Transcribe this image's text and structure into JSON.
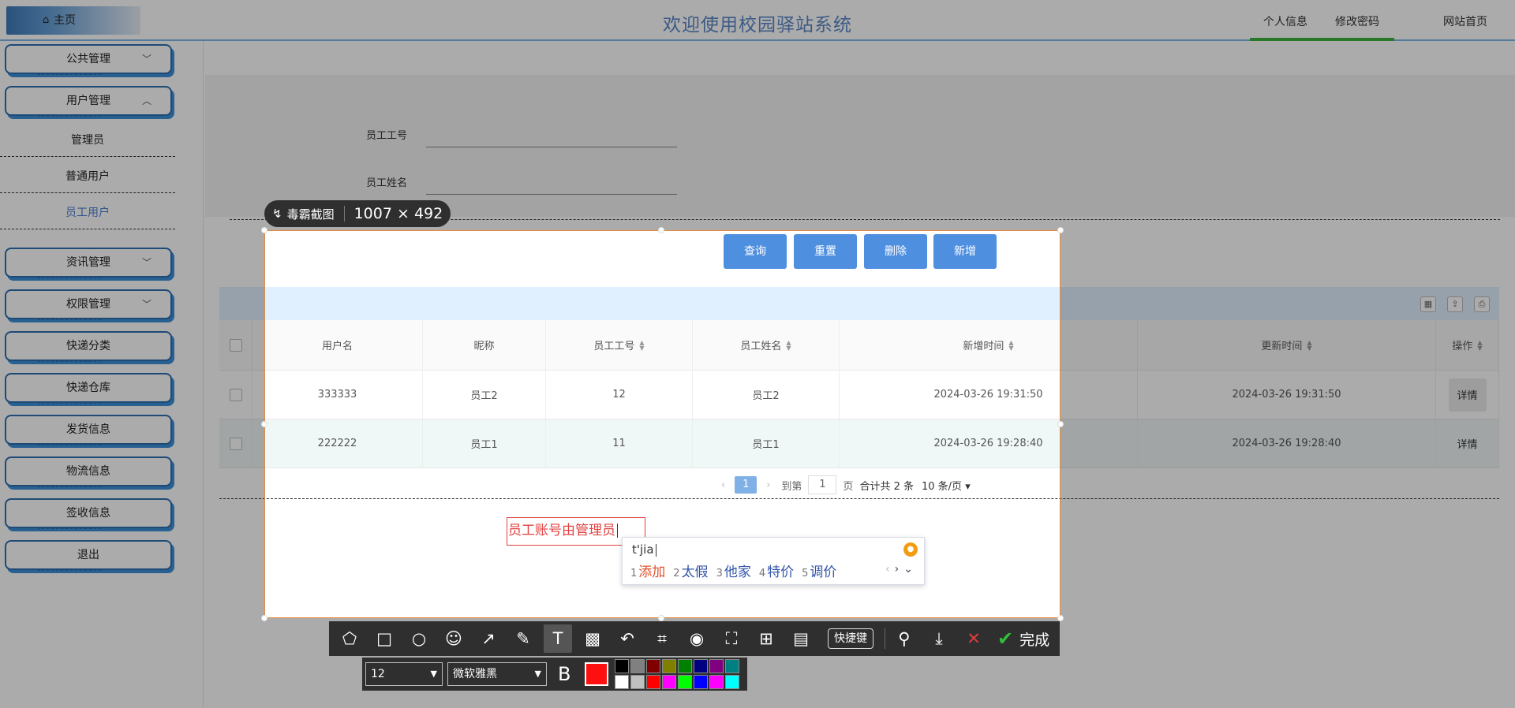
{
  "header": {
    "home": "主页",
    "title": "欢迎使用校园驿站系统",
    "links": [
      "个人信息",
      "修改密码",
      "网站首页"
    ]
  },
  "sidebar": {
    "menus": [
      {
        "label": "公共管理",
        "chevron": "chevron-down"
      },
      {
        "label": "用户管理",
        "chevron": "chevron-up"
      }
    ],
    "submenu": [
      "管理员",
      "普通用户",
      "员工用户"
    ],
    "menus2": [
      {
        "label": "资讯管理",
        "chevron": "chevron-down"
      },
      {
        "label": "权限管理",
        "chevron": "chevron-down"
      },
      {
        "label": "快递分类",
        "chevron": ""
      },
      {
        "label": "快递仓库",
        "chevron": ""
      },
      {
        "label": "发货信息",
        "chevron": ""
      },
      {
        "label": "物流信息",
        "chevron": ""
      },
      {
        "label": "签收信息",
        "chevron": ""
      },
      {
        "label": "退出",
        "chevron": ""
      }
    ]
  },
  "search": {
    "field1_label": "员工工号",
    "field2_label": "员工姓名",
    "buttons": [
      "查询",
      "重置",
      "删除",
      "新增"
    ]
  },
  "table": {
    "headers": [
      "用户名",
      "昵称",
      "员工工号",
      "员工姓名",
      "新增时间",
      "更新时间",
      "操作"
    ],
    "rows": [
      [
        "333333",
        "员工2",
        "12",
        "员工2",
        "2024-03-26 19:31:50",
        "2024-03-26 19:31:50",
        "详情"
      ],
      [
        "222222",
        "员工1",
        "11",
        "员工1",
        "2024-03-26 19:28:40",
        "2024-03-26 19:28:40",
        "详情"
      ]
    ]
  },
  "pager": {
    "current": "1",
    "goto_label": "到第",
    "goto_value": "1",
    "page_unit": "页",
    "total": "合计共 2 条",
    "page_size": "10 条/页"
  },
  "screenshot_tool": {
    "app_name": "毒霸截图",
    "size": "1007 × 492",
    "annotation_text": "员工账号由管理员",
    "ime_input": "t'jia",
    "ime_candidates": [
      {
        "num": "1",
        "text": "添加"
      },
      {
        "num": "2",
        "text": "太假"
      },
      {
        "num": "3",
        "text": "他家"
      },
      {
        "num": "4",
        "text": "特价"
      },
      {
        "num": "5",
        "text": "调价"
      }
    ],
    "shortcut_label": "快捷键",
    "done_label": "完成",
    "font_size": "12",
    "font_name": "微软雅黑",
    "bold_label": "B",
    "current_color": "#ff1010",
    "palette": [
      "#000000",
      "#808080",
      "#800000",
      "#808000",
      "#008000",
      "#000080",
      "#800080",
      "#008080",
      "#ffffff",
      "#c0c0c0",
      "#ff0000",
      "#ff00ff",
      "#00ff00",
      "#0000ff",
      "#ff00ff",
      "#00ffff"
    ]
  }
}
